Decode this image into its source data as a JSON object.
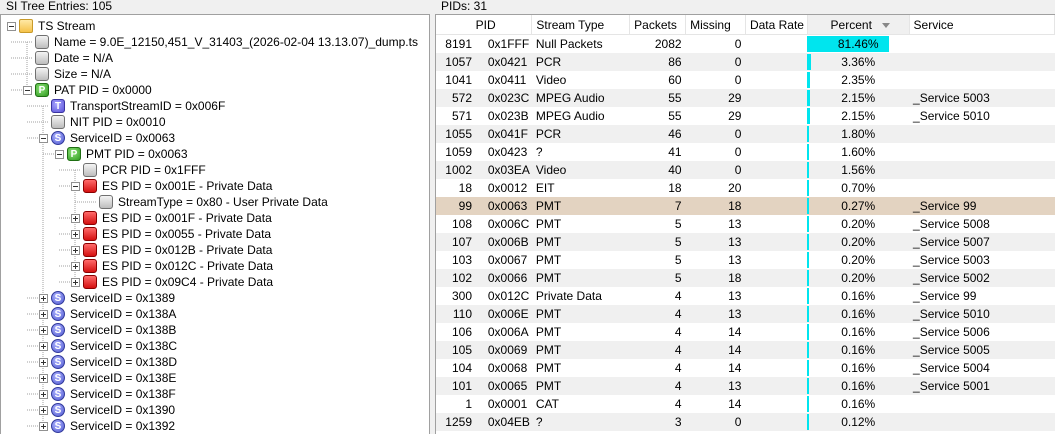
{
  "left_header": "SI Tree Entries: 105",
  "right_header": "PIDs: 31",
  "tree": [
    {
      "depth": 0,
      "toggle": "minus",
      "icon": "folder",
      "label": "TS Stream"
    },
    {
      "depth": 1,
      "toggle": "none",
      "icon": "gray",
      "label": "Name = 9.0E_12150,451_V_31403_(2026-02-04 13.13.07)_dump.ts"
    },
    {
      "depth": 1,
      "toggle": "none",
      "icon": "gray",
      "label": "Date = N/A"
    },
    {
      "depth": 1,
      "toggle": "none",
      "icon": "gray",
      "label": "Size = N/A"
    },
    {
      "depth": 1,
      "toggle": "minus",
      "icon": "p",
      "label": "PAT PID = 0x0000"
    },
    {
      "depth": 2,
      "toggle": "none",
      "icon": "t",
      "label": "TransportStreamID = 0x006F"
    },
    {
      "depth": 2,
      "toggle": "none",
      "icon": "gray",
      "label": "NIT PID = 0x0010"
    },
    {
      "depth": 2,
      "toggle": "minus",
      "icon": "s",
      "label": "ServiceID = 0x0063"
    },
    {
      "depth": 3,
      "toggle": "minus",
      "icon": "p",
      "label": "PMT PID = 0x0063"
    },
    {
      "depth": 4,
      "toggle": "none",
      "icon": "gray",
      "label": "PCR PID = 0x1FFF"
    },
    {
      "depth": 4,
      "toggle": "minus",
      "icon": "red",
      "label": "ES PID = 0x001E - Private Data"
    },
    {
      "depth": 5,
      "toggle": "none",
      "icon": "gray",
      "label": "StreamType = 0x80 - User Private Data"
    },
    {
      "depth": 4,
      "toggle": "plus",
      "icon": "red",
      "label": "ES PID = 0x001F - Private Data"
    },
    {
      "depth": 4,
      "toggle": "plus",
      "icon": "red",
      "label": "ES PID = 0x0055 - Private Data"
    },
    {
      "depth": 4,
      "toggle": "plus",
      "icon": "red",
      "label": "ES PID = 0x012B - Private Data"
    },
    {
      "depth": 4,
      "toggle": "plus",
      "icon": "red",
      "label": "ES PID = 0x012C - Private Data"
    },
    {
      "depth": 4,
      "toggle": "plus",
      "icon": "red",
      "label": "ES PID = 0x09C4 - Private Data"
    },
    {
      "depth": 2,
      "toggle": "plus",
      "icon": "s",
      "label": "ServiceID = 0x1389"
    },
    {
      "depth": 2,
      "toggle": "plus",
      "icon": "s",
      "label": "ServiceID = 0x138A"
    },
    {
      "depth": 2,
      "toggle": "plus",
      "icon": "s",
      "label": "ServiceID = 0x138B"
    },
    {
      "depth": 2,
      "toggle": "plus",
      "icon": "s",
      "label": "ServiceID = 0x138C"
    },
    {
      "depth": 2,
      "toggle": "plus",
      "icon": "s",
      "label": "ServiceID = 0x138D"
    },
    {
      "depth": 2,
      "toggle": "plus",
      "icon": "s",
      "label": "ServiceID = 0x138E"
    },
    {
      "depth": 2,
      "toggle": "plus",
      "icon": "s",
      "label": "ServiceID = 0x138F"
    },
    {
      "depth": 2,
      "toggle": "plus",
      "icon": "s",
      "label": "ServiceID = 0x1390"
    },
    {
      "depth": 2,
      "toggle": "plus",
      "icon": "s",
      "label": "ServiceID = 0x1392"
    }
  ],
  "table": {
    "columns": [
      "PID",
      "Stream Type",
      "Packets",
      "Missing",
      "Data Rate",
      "Percent",
      "Service"
    ],
    "sorted_column": "Percent",
    "accent_bar_color": "#00e5ee",
    "selected_color": "#e3d3c1",
    "rows": [
      {
        "pid_dec": "8191",
        "pid_hex": "0x1FFF",
        "type": "Null Packets",
        "packets": "2082",
        "missing": "0",
        "rate": "",
        "percent": "81.46%",
        "pct": 81.46,
        "service": ""
      },
      {
        "pid_dec": "1057",
        "pid_hex": "0x0421",
        "type": "PCR",
        "packets": "86",
        "missing": "0",
        "rate": "",
        "percent": "3.36%",
        "pct": 3.36,
        "service": ""
      },
      {
        "pid_dec": "1041",
        "pid_hex": "0x0411",
        "type": "Video",
        "packets": "60",
        "missing": "0",
        "rate": "",
        "percent": "2.35%",
        "pct": 2.35,
        "service": ""
      },
      {
        "pid_dec": "572",
        "pid_hex": "0x023C",
        "type": "MPEG Audio",
        "packets": "55",
        "missing": "29",
        "rate": "",
        "percent": "2.15%",
        "pct": 2.15,
        "service": "_Service 5003"
      },
      {
        "pid_dec": "571",
        "pid_hex": "0x023B",
        "type": "MPEG Audio",
        "packets": "55",
        "missing": "29",
        "rate": "",
        "percent": "2.15%",
        "pct": 2.15,
        "service": "_Service 5010"
      },
      {
        "pid_dec": "1055",
        "pid_hex": "0x041F",
        "type": "PCR",
        "packets": "46",
        "missing": "0",
        "rate": "",
        "percent": "1.80%",
        "pct": 1.8,
        "service": ""
      },
      {
        "pid_dec": "1059",
        "pid_hex": "0x0423",
        "type": "?",
        "packets": "41",
        "missing": "0",
        "rate": "",
        "percent": "1.60%",
        "pct": 1.6,
        "service": ""
      },
      {
        "pid_dec": "1002",
        "pid_hex": "0x03EA",
        "type": "Video",
        "packets": "40",
        "missing": "0",
        "rate": "",
        "percent": "1.56%",
        "pct": 1.56,
        "service": ""
      },
      {
        "pid_dec": "18",
        "pid_hex": "0x0012",
        "type": "EIT",
        "packets": "18",
        "missing": "20",
        "rate": "",
        "percent": "0.70%",
        "pct": 0.7,
        "service": ""
      },
      {
        "pid_dec": "99",
        "pid_hex": "0x0063",
        "type": "PMT",
        "packets": "7",
        "missing": "18",
        "rate": "",
        "percent": "0.27%",
        "pct": 0.27,
        "service": "_Service 99",
        "selected": true
      },
      {
        "pid_dec": "108",
        "pid_hex": "0x006C",
        "type": "PMT",
        "packets": "5",
        "missing": "13",
        "rate": "",
        "percent": "0.20%",
        "pct": 0.2,
        "service": "_Service 5008"
      },
      {
        "pid_dec": "107",
        "pid_hex": "0x006B",
        "type": "PMT",
        "packets": "5",
        "missing": "13",
        "rate": "",
        "percent": "0.20%",
        "pct": 0.2,
        "service": "_Service 5007"
      },
      {
        "pid_dec": "103",
        "pid_hex": "0x0067",
        "type": "PMT",
        "packets": "5",
        "missing": "13",
        "rate": "",
        "percent": "0.20%",
        "pct": 0.2,
        "service": "_Service 5003"
      },
      {
        "pid_dec": "102",
        "pid_hex": "0x0066",
        "type": "PMT",
        "packets": "5",
        "missing": "18",
        "rate": "",
        "percent": "0.20%",
        "pct": 0.2,
        "service": "_Service 5002"
      },
      {
        "pid_dec": "300",
        "pid_hex": "0x012C",
        "type": "Private Data",
        "packets": "4",
        "missing": "13",
        "rate": "",
        "percent": "0.16%",
        "pct": 0.16,
        "service": "_Service 99"
      },
      {
        "pid_dec": "110",
        "pid_hex": "0x006E",
        "type": "PMT",
        "packets": "4",
        "missing": "13",
        "rate": "",
        "percent": "0.16%",
        "pct": 0.16,
        "service": "_Service 5010"
      },
      {
        "pid_dec": "106",
        "pid_hex": "0x006A",
        "type": "PMT",
        "packets": "4",
        "missing": "14",
        "rate": "",
        "percent": "0.16%",
        "pct": 0.16,
        "service": "_Service 5006"
      },
      {
        "pid_dec": "105",
        "pid_hex": "0x0069",
        "type": "PMT",
        "packets": "4",
        "missing": "14",
        "rate": "",
        "percent": "0.16%",
        "pct": 0.16,
        "service": "_Service 5005"
      },
      {
        "pid_dec": "104",
        "pid_hex": "0x0068",
        "type": "PMT",
        "packets": "4",
        "missing": "14",
        "rate": "",
        "percent": "0.16%",
        "pct": 0.16,
        "service": "_Service 5004"
      },
      {
        "pid_dec": "101",
        "pid_hex": "0x0065",
        "type": "PMT",
        "packets": "4",
        "missing": "13",
        "rate": "",
        "percent": "0.16%",
        "pct": 0.16,
        "service": "_Service 5001"
      },
      {
        "pid_dec": "1",
        "pid_hex": "0x0001",
        "type": "CAT",
        "packets": "4",
        "missing": "14",
        "rate": "",
        "percent": "0.16%",
        "pct": 0.16,
        "service": ""
      },
      {
        "pid_dec": "1259",
        "pid_hex": "0x04EB",
        "type": "?",
        "packets": "3",
        "missing": "0",
        "rate": "",
        "percent": "0.12%",
        "pct": 0.12,
        "service": ""
      }
    ]
  }
}
